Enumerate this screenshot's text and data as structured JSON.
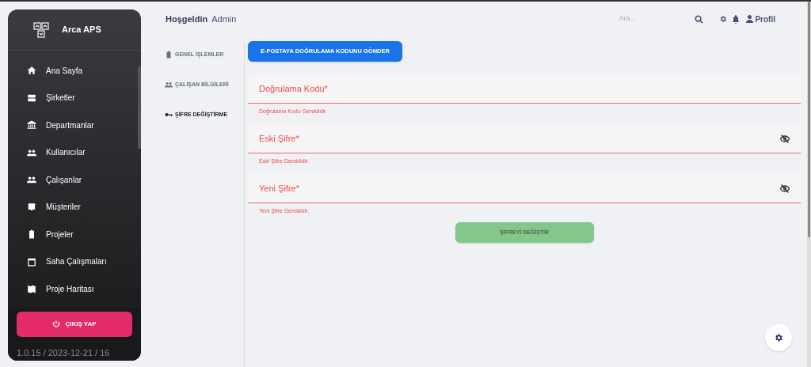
{
  "sidebar": {
    "brand": "Arca APS",
    "items": [
      {
        "label": "Ana Sayfa",
        "kind": "home"
      },
      {
        "label": "Şirketler",
        "kind": "server"
      },
      {
        "label": "Departmanlar",
        "kind": "bank"
      },
      {
        "label": "Kullanıcılar",
        "kind": "people"
      },
      {
        "label": "Çalışanlar",
        "kind": "people"
      },
      {
        "label": "Müşteriler",
        "kind": "contact"
      },
      {
        "label": "Projeler",
        "kind": "clipboard"
      },
      {
        "label": "Saha Çalışmaları",
        "kind": "calendar"
      },
      {
        "label": "Proje Haritası",
        "kind": "map"
      }
    ],
    "logout": "ÇIKIŞ YAP",
    "version": "1.0.15 / 2023-12-21 / 16"
  },
  "header": {
    "greeting": "Hoşgeldin",
    "user": "Admin",
    "search": {
      "placeholder": "Ara..."
    },
    "profile": "Profil"
  },
  "tabs": [
    {
      "label": "GENEL İŞLEMLER",
      "kind": "clipboard",
      "selected": false
    },
    {
      "label": "ÇALIŞAN BİLGİLERİ",
      "kind": "people",
      "selected": false
    },
    {
      "label": "ŞİFRE DEĞİŞTİRME",
      "kind": "key",
      "selected": true
    }
  ],
  "send_code_button": "E-POSTAYA DOĞRULAMA KODUNU GÖNDER",
  "fields": [
    {
      "kind": "text",
      "label": "Doğrulama Kodu*",
      "error": "Doğrulama Kodu Gereklidir."
    },
    {
      "kind": "password",
      "label": "Eski Şifre*",
      "error": "Eski Şifre Gereklidir."
    },
    {
      "kind": "password",
      "label": "Yeni Şifre*",
      "error": "Yeni Şifre Gereklidir."
    }
  ],
  "submit_button": {
    "label": "ŞİFREYİ DEĞİŞTİR",
    "disabled": true
  }
}
